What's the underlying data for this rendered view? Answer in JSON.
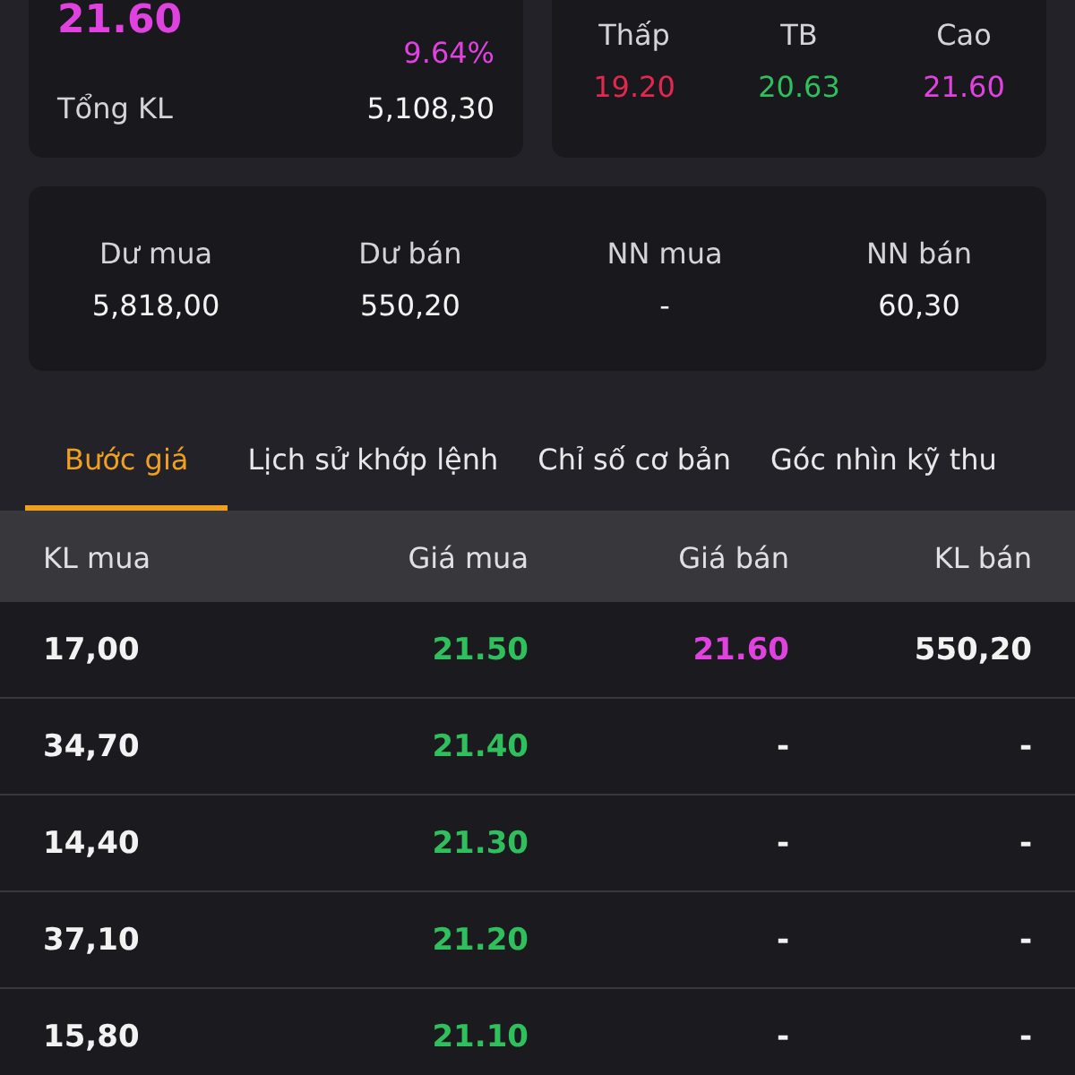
{
  "summary": {
    "price": "21.60",
    "change_percent": "9.64%",
    "total_volume_label": "Tổng KL",
    "total_volume": "5,108,30"
  },
  "range": [
    {
      "label": "Thấp",
      "value": "19.20",
      "color": "#e3284f"
    },
    {
      "label": "TB",
      "value": "20.63",
      "color": "#2fbf5c"
    },
    {
      "label": "Cao",
      "value": "21.60",
      "color": "#e042e0"
    }
  ],
  "balances": [
    {
      "label": "Dư mua",
      "value": "5,818,00"
    },
    {
      "label": "Dư bán",
      "value": "550,20"
    },
    {
      "label": "NN mua",
      "value": "-"
    },
    {
      "label": "NN bán",
      "value": "60,30"
    }
  ],
  "tabs": [
    {
      "label": "Bước giá",
      "selected": true
    },
    {
      "label": "Lịch sử khớp lệnh",
      "selected": false
    },
    {
      "label": "Chỉ số cơ bản",
      "selected": false
    },
    {
      "label": "Góc nhìn kỹ thu",
      "selected": false
    }
  ],
  "table": {
    "columns": [
      "KL mua",
      "Giá mua",
      "Giá bán",
      "KL bán"
    ],
    "rows": [
      {
        "buy_volume": "17,00",
        "buy_price": {
          "value": "21.50",
          "color": "#2fbf5c"
        },
        "sell_price": {
          "value": "21.60",
          "color": "#e042e0"
        },
        "sell_volume": "550,20"
      },
      {
        "buy_volume": "34,70",
        "buy_price": {
          "value": "21.40",
          "color": "#2fbf5c"
        },
        "sell_price": {
          "value": "-"
        },
        "sell_volume": "-"
      },
      {
        "buy_volume": "14,40",
        "buy_price": {
          "value": "21.30",
          "color": "#2fbf5c"
        },
        "sell_price": {
          "value": "-"
        },
        "sell_volume": "-"
      },
      {
        "buy_volume": "37,10",
        "buy_price": {
          "value": "21.20",
          "color": "#2fbf5c"
        },
        "sell_price": {
          "value": "-"
        },
        "sell_volume": "-"
      },
      {
        "buy_volume": "15,80",
        "buy_price": {
          "value": "21.10",
          "color": "#2fbf5c"
        },
        "sell_price": {
          "value": "-"
        },
        "sell_volume": "-"
      }
    ]
  }
}
